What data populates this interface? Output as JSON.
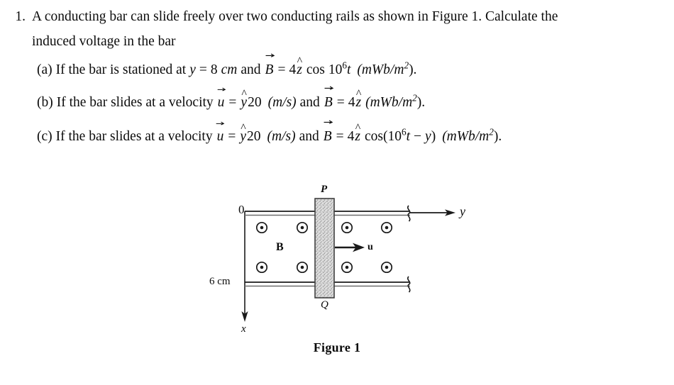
{
  "document": {
    "background_color": "#ffffff",
    "text_color": "#0b0b0b"
  },
  "problem": {
    "number": "1.",
    "stem_line1": "A conducting bar can slide freely over two conducting rails as shown in Figure 1. Calculate the",
    "stem_line2": "induced voltage in the bar",
    "parts": [
      {
        "label": "(a)",
        "text_before": "If the bar is stationed at",
        "var_y": "y",
        "eq1": "=",
        "value_y": "8",
        "unit_y": "cm",
        "conj": "and",
        "vector_B": "B",
        "eq2": "=",
        "coef": "4",
        "unit_vec": "z",
        "func": "cos",
        "base": "10",
        "exponent": "6",
        "time_var": "t",
        "units": "(mWb/m",
        "units_exp": "2",
        "units_close": ")."
      },
      {
        "label": "(b)",
        "text_before": "If the bar slides at a velocity",
        "vector_u": "u",
        "eq1": "=",
        "unit_vec_y": "y",
        "value_u": "20",
        "unit_u": "(m/s)",
        "conj": "and",
        "vector_B": "B",
        "eq2": "=",
        "coef": "4",
        "unit_vec": "z",
        "units": "(mWb/m",
        "units_exp": "2",
        "units_close": ")."
      },
      {
        "label": "(c)",
        "text_before": "If the bar slides at a velocity",
        "vector_u": "u",
        "eq1": "=",
        "unit_vec_y": "y",
        "value_u": "20",
        "unit_u": "(m/s)",
        "conj": "and",
        "vector_B": "B",
        "eq2": "=",
        "coef": "4",
        "unit_vec": "z",
        "func": "cos(",
        "base": "10",
        "exponent": "6",
        "time_var": "t",
        "minus": "−",
        "y_var": "y",
        "func_close": ")",
        "units": "(mWb/m",
        "units_exp": "2",
        "units_close": ")."
      }
    ]
  },
  "figure": {
    "caption": "Figure 1",
    "axis_origin_label": "0",
    "axis_y_label": "y",
    "axis_x_label": "x",
    "width_label": "6 cm",
    "field_label": "B",
    "velocity_label": "u",
    "bar_top_label": "P",
    "bar_bottom_label": "Q",
    "field_symbol": "dot-in-circle",
    "field_direction": "out-of-page",
    "field_dot_count": 8,
    "colors": {
      "line": "#1a1a1a",
      "bar_fill": "#d9d9d9",
      "bar_stroke": "#3a3a3a"
    }
  }
}
